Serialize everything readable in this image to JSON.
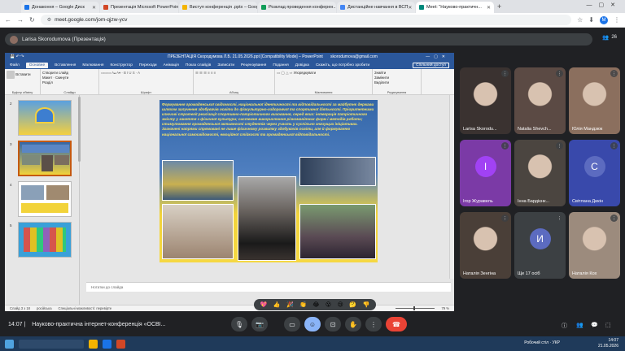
{
  "browser": {
    "tabs": [
      {
        "label": "Донаконня – Google Диск",
        "color": "#1a73e8",
        "active": false
      },
      {
        "label": "Презентація Microsoft PowerPoint",
        "color": "#d24726",
        "active": false
      },
      {
        "label": "Виступ конференція .pptx – Google",
        "color": "#f4b400",
        "active": false
      },
      {
        "label": "Розклад проведення конферен...",
        "color": "#0f9d58",
        "active": false
      },
      {
        "label": "Дистанційне навчання в ВСП",
        "color": "#4285f4",
        "active": false
      },
      {
        "label": "Meet: \"Науково-практичн...",
        "color": "#00897b",
        "active": true
      }
    ],
    "url": "meet.google.com/jom-qjzw-ycv"
  },
  "meet": {
    "presenter_name": "Larisa Skorodumova (Презентація)",
    "people_count": "26",
    "time": "14:07",
    "meeting_name": "Науково-практична інтернет-конференція «ОСВІ...",
    "reactions": [
      "💖",
      "👍",
      "🎉",
      "👏",
      "😂",
      "😮",
      "😢",
      "🤔",
      "👎"
    ],
    "participants": [
      {
        "name": "Larisa Skorodu...",
        "type": "video",
        "color": "#3a3230"
      },
      {
        "name": "Natalia Shevch...",
        "type": "video",
        "color": "#5b4a44"
      },
      {
        "name": "Юлія Мандзюк",
        "type": "video",
        "color": "#8b6f5e"
      },
      {
        "name": "Ігор Журавель",
        "type": "letter",
        "letter": "І",
        "bg": "#7b3aa6",
        "circle": "#a142f4"
      },
      {
        "name": "Інна Бардієнк...",
        "type": "video",
        "color": "#4b4540"
      },
      {
        "name": "Світлана Дикін",
        "type": "letter",
        "letter": "С",
        "bg": "#3949ab",
        "circle": "#5c6bc0"
      },
      {
        "name": "Наталія Зенгіна",
        "type": "video",
        "color": "#4a3f38"
      },
      {
        "name": "Ще 17 осіб",
        "type": "more",
        "letter": "И",
        "color": "#3c4043"
      },
      {
        "name": "Наталія Кох",
        "type": "video",
        "color": "#9c8b7d"
      }
    ]
  },
  "ppt": {
    "title": "ПРЕЗЕНТАЦІЯ Скородумова Л.Б. 21.05.2026.ppt [Compatibility Mode] – PowerPoint",
    "user": "skorodumova@gmail.com",
    "tabs": [
      "Файл",
      "Основне",
      "Вставлення",
      "Малювання",
      "Конструктор",
      "Переходи",
      "Анімація",
      "Показ слайдів",
      "Записати",
      "Рецензування",
      "Подання",
      "Довідка",
      "Скажіть, що потрібно зробити"
    ],
    "access_label": "Спільний доступ",
    "ribbon_groups": [
      "Буфер обміну",
      "Слайди",
      "Шрифт",
      "Абзац",
      "Малювання",
      "Редагування"
    ],
    "ribbon_items": {
      "paste": "Вставити",
      "new_slide": "Створити слайд",
      "layout": "Макет",
      "reset": "Скинути",
      "section": "Розділ",
      "arrange": "Упорядкувати",
      "find": "Знайти",
      "replace": "Замінити",
      "select": "Виділити"
    },
    "slide_numbers": [
      "2",
      "3",
      "4",
      "5"
    ],
    "slide_text": "Формування громадянської свідомості, національної ідентичності та відповідальності за майбутнє держави шляхом залучення здобувачів освіти до фізкультурно-оздоровчої та спортивної діяльності. Пріоритетними ключові стратегії реалізації спортивно-патріотичного виховання, серед яких: інтеграція патріотичного змісту у заняття з фізичної культури; системне використання різноманітних форм і методів роботи; стимулювання громадянської активності студентів через участь у суспільно значущих ініціативах. Зазначені напрями спрямовані не лише фізичному розвитку здобувачів освіти, але й формуванню національної самосвідомості, емоційної стійкості та громадянської відповідальності.",
    "notes_placeholder": "Нотатки до слайда",
    "status_left": "Слайд 3 з 18",
    "status_lang": "російська",
    "status_access": "Спеціальні можливості: перевірте",
    "status_notes": "Нотатки",
    "status_comments": "Примітки",
    "zoom": "79 %"
  },
  "taskbar": {
    "weather": "Робочий стіл",
    "lang": "УКР",
    "clock_time": "14:07",
    "clock_date": "21.05.2026"
  }
}
